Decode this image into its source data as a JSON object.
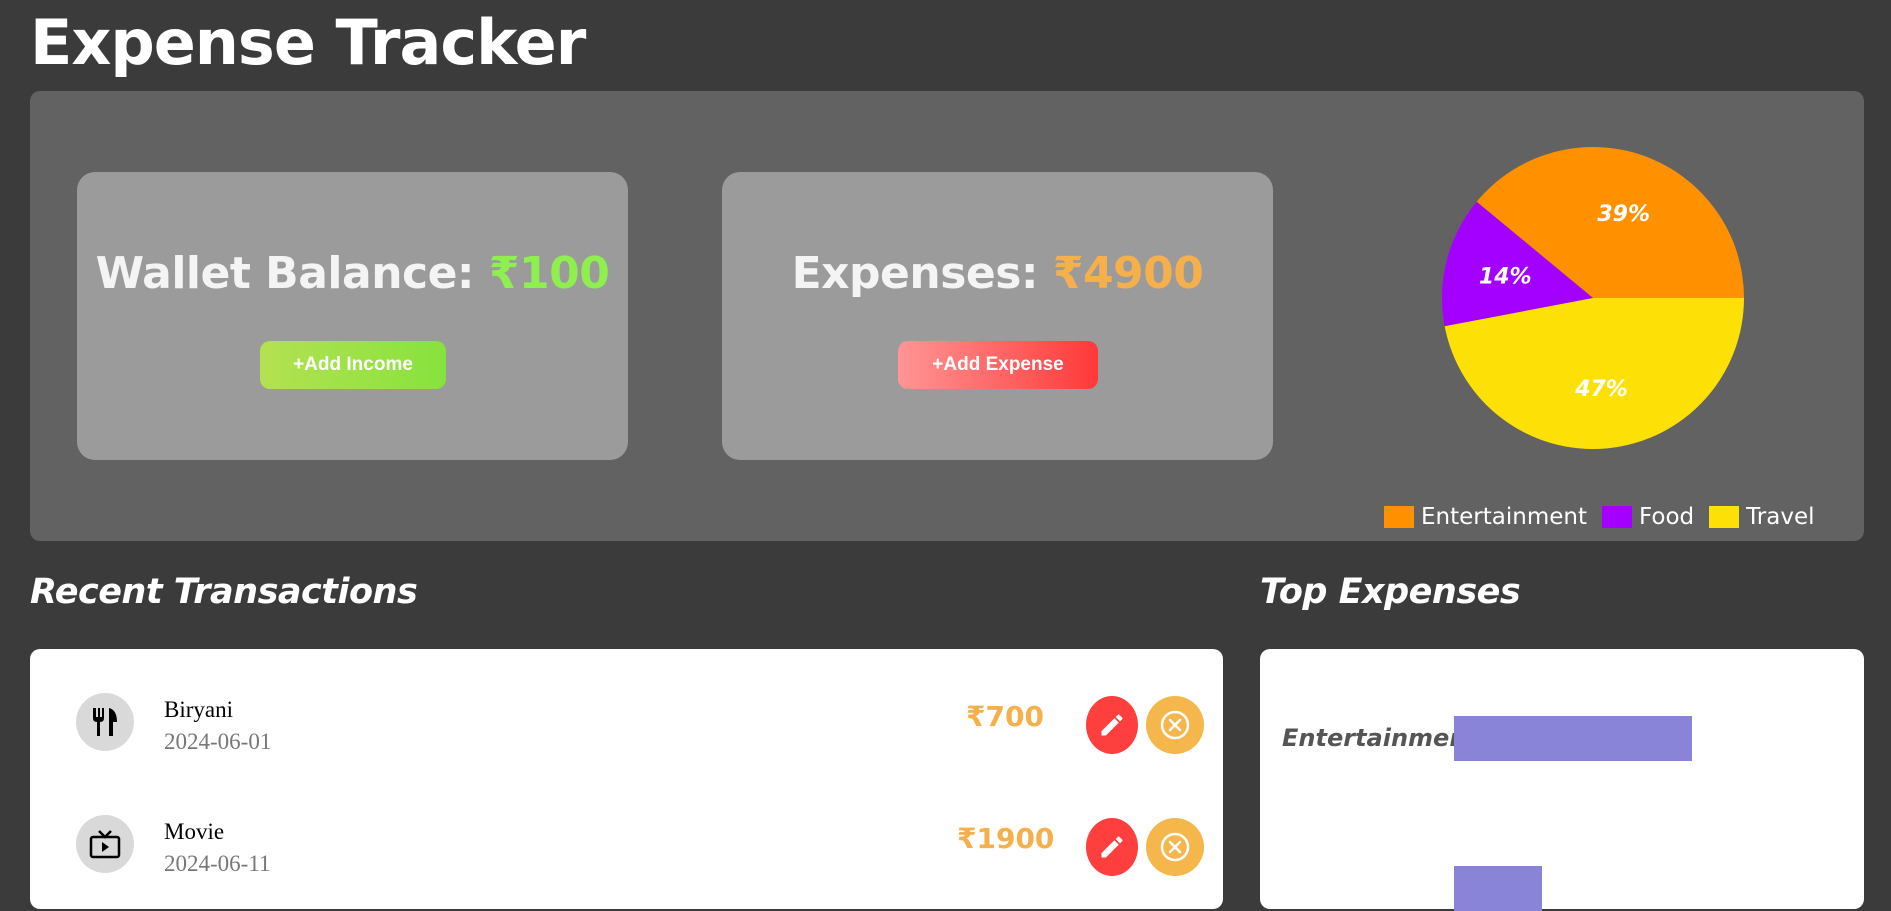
{
  "app": {
    "title": "Expense Tracker"
  },
  "wallet": {
    "label": "Wallet Balance: ",
    "amount": "₹100",
    "button": "+Add Income"
  },
  "expenses": {
    "label": "Expenses: ",
    "amount": "₹4900",
    "button": "+Add Expense"
  },
  "chart_data": [
    {
      "type": "pie",
      "slices": [
        {
          "name": "Entertainment",
          "value": 39,
          "label": "39%",
          "color": "#ff9100"
        },
        {
          "name": "Food",
          "value": 14,
          "label": "14%",
          "color": "#a400ff"
        },
        {
          "name": "Travel",
          "value": 47,
          "label": "47%",
          "color": "#fde006"
        }
      ],
      "legend_position": "bottom-right"
    },
    {
      "type": "bar",
      "orientation": "horizontal",
      "categories": [
        "Entertainment",
        ""
      ],
      "values": [
        1900,
        700
      ],
      "color": "#8a84d8"
    }
  ],
  "sections": {
    "recent": "Recent Transactions",
    "top": "Top Expenses"
  },
  "transactions": [
    {
      "name": "Biryani",
      "date": "2024-06-01",
      "amount": "₹700",
      "icon": "fork-knife-icon"
    },
    {
      "name": "Movie",
      "date": "2024-06-11",
      "amount": "₹1900",
      "icon": "tv-play-icon"
    }
  ],
  "colors": {
    "background": "#3b3b3b",
    "hero": "#626262",
    "card": "#9b9b9b",
    "income_green": "#8ef04e",
    "expense_orange": "#f5b04c",
    "edit_red": "#ff3e3e",
    "delete_yellow": "#f5b64c",
    "bar": "#8a84d8"
  }
}
